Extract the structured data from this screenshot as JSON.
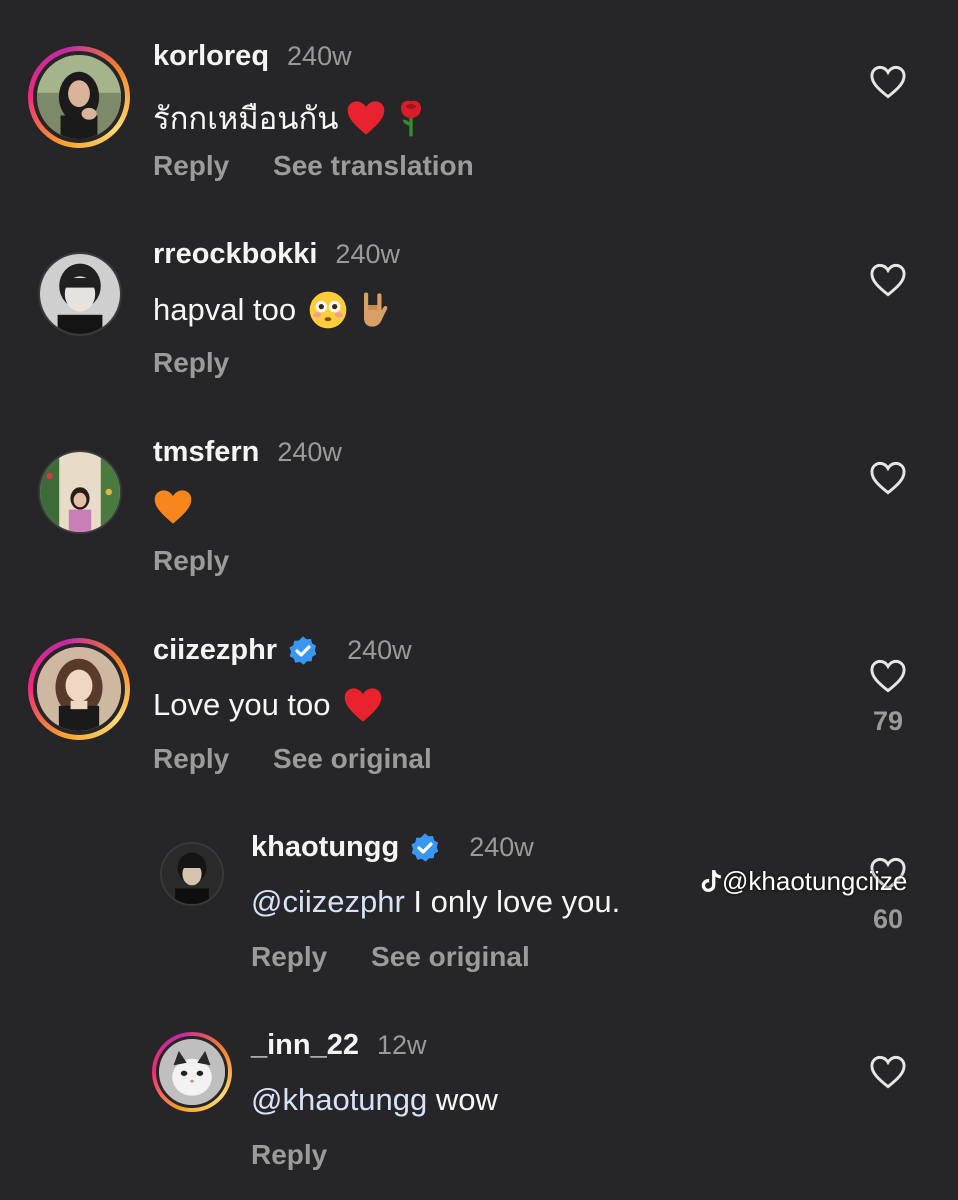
{
  "comments": [
    {
      "username": "korloreq",
      "time": "240w",
      "text": "รักกเหมือนกัน",
      "actions": [
        "Reply",
        "See translation"
      ],
      "likes": ""
    },
    {
      "username": "rreockbokki",
      "time": "240w",
      "text": "hapval too",
      "actions": [
        "Reply"
      ],
      "likes": ""
    },
    {
      "username": "tmsfern",
      "time": "240w",
      "text": "",
      "actions": [
        "Reply"
      ],
      "likes": ""
    },
    {
      "username": "ciizezphr",
      "time": "240w",
      "text": "Love you too",
      "actions": [
        "Reply",
        "See original"
      ],
      "likes": "79"
    },
    {
      "username": "khaotungg",
      "time": "240w",
      "mention": "@ciizezphr",
      "text": " I only love you.",
      "actions": [
        "Reply",
        "See original"
      ],
      "likes": "60"
    },
    {
      "username": "_inn_22",
      "time": "12w",
      "mention": "@khaotungg",
      "text": " wow",
      "actions": [
        "Reply"
      ],
      "likes": ""
    }
  ],
  "watermark": "@khaotungciize",
  "colors": {
    "background": "#262628",
    "secondary_text": "#9a9a9a",
    "verified_blue": "#3897f0",
    "heart_red": "#e8232d",
    "heart_orange": "#f7861c"
  }
}
